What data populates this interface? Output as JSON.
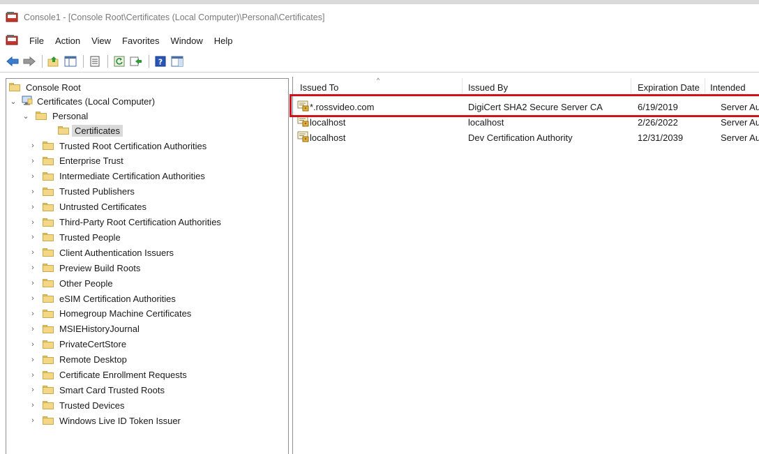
{
  "window": {
    "title": "Console1 - [Console Root\\Certificates (Local Computer)\\Personal\\Certificates]"
  },
  "menu": {
    "items": [
      "File",
      "Action",
      "View",
      "Favorites",
      "Window",
      "Help"
    ]
  },
  "toolbar": {
    "icons": [
      "back-arrow-icon",
      "forward-arrow-icon",
      "up-folder-icon",
      "show-hide-tree-icon",
      "properties-icon",
      "refresh-icon",
      "export-list-icon",
      "help-icon",
      "show-action-pane-icon"
    ]
  },
  "tree": {
    "root": "Console Root",
    "store": "Certificates (Local Computer)",
    "personal": "Personal",
    "selected": "Certificates",
    "folders": [
      "Trusted Root Certification Authorities",
      "Enterprise Trust",
      "Intermediate Certification Authorities",
      "Trusted Publishers",
      "Untrusted Certificates",
      "Third-Party Root Certification Authorities",
      "Trusted People",
      "Client Authentication Issuers",
      "Preview Build Roots",
      "Other People",
      "eSIM Certification Authorities",
      "Homegroup Machine Certificates",
      "MSIEHistoryJournal",
      "PrivateCertStore",
      "Remote Desktop",
      "Certificate Enrollment Requests",
      "Smart Card Trusted Roots",
      "Trusted Devices",
      "Windows Live ID Token Issuer"
    ]
  },
  "list": {
    "columns": [
      "Issued To",
      "Issued By",
      "Expiration Date",
      "Intended"
    ],
    "rows": [
      {
        "issued_to": "*.rossvideo.com",
        "issued_by": "DigiCert SHA2 Secure Server CA",
        "expiration": "6/19/2019",
        "intended": "Server Au"
      },
      {
        "issued_to": "localhost",
        "issued_by": "localhost",
        "expiration": "2/26/2022",
        "intended": "Server Au"
      },
      {
        "issued_to": "localhost",
        "issued_by": "Dev Certification Authority",
        "expiration": "12/31/2039",
        "intended": "Server Au"
      }
    ]
  },
  "colors": {
    "highlight_border": "#d0121b",
    "selection": "#d9d9d9",
    "folder": "#f4d784"
  }
}
